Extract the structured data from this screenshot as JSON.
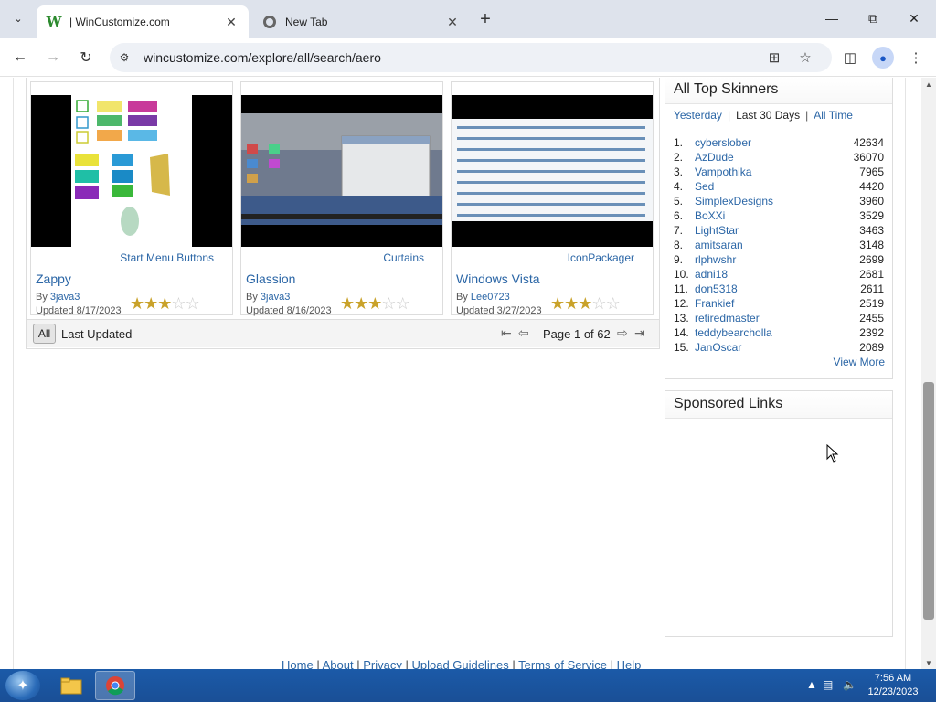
{
  "browser": {
    "tabs": [
      {
        "title": "| WinCustomize.com",
        "active": true
      },
      {
        "title": "New Tab",
        "active": false
      }
    ],
    "url": "wincustomize.com/explore/all/search/aero"
  },
  "results": [
    {
      "category": "Start Menu Buttons",
      "title": "Zappy",
      "by_prefix": "By",
      "author": "3java3",
      "updated": "Updated 8/17/2023",
      "rating": 3
    },
    {
      "category": "Curtains",
      "title": "Glassion",
      "by_prefix": "By",
      "author": "3java3",
      "updated": "Updated 8/16/2023",
      "rating": 3
    },
    {
      "category": "IconPackager",
      "title": "Windows Vista",
      "by_prefix": "By",
      "author": "Lee0723",
      "updated": "Updated 3/27/2023",
      "rating": 3
    }
  ],
  "pager": {
    "all_label": "All",
    "sort_label": "Last Updated",
    "page_info": "Page 1 of 62"
  },
  "top_skinners": {
    "title": "All Top Skinners",
    "filters": {
      "yesterday": "Yesterday",
      "last30": "Last 30 Days",
      "alltime": "All Time",
      "sep": "|"
    },
    "list": [
      {
        "rank": "1.",
        "name": "cyberslober",
        "count": "42634"
      },
      {
        "rank": "2.",
        "name": "AzDude",
        "count": "36070"
      },
      {
        "rank": "3.",
        "name": "Vampothika",
        "count": "7965"
      },
      {
        "rank": "4.",
        "name": "Sed",
        "count": "4420"
      },
      {
        "rank": "5.",
        "name": "SimplexDesigns",
        "count": "3960"
      },
      {
        "rank": "6.",
        "name": "BoXXi",
        "count": "3529"
      },
      {
        "rank": "7.",
        "name": "LightStar",
        "count": "3463"
      },
      {
        "rank": "8.",
        "name": "amitsaran",
        "count": "3148"
      },
      {
        "rank": "9.",
        "name": "rlphwshr",
        "count": "2699"
      },
      {
        "rank": "10.",
        "name": "adni18",
        "count": "2681"
      },
      {
        "rank": "11.",
        "name": "don5318",
        "count": "2611"
      },
      {
        "rank": "12.",
        "name": "Frankief",
        "count": "2519"
      },
      {
        "rank": "13.",
        "name": "retiredmaster",
        "count": "2455"
      },
      {
        "rank": "14.",
        "name": "teddybearcholla",
        "count": "2392"
      },
      {
        "rank": "15.",
        "name": "JanOscar",
        "count": "2089"
      }
    ],
    "view_more": "View More"
  },
  "sponsored": {
    "title": "Sponsored Links"
  },
  "footer": {
    "links": [
      "Home",
      "About",
      "Privacy",
      "Upload Guidelines",
      "Terms of Service",
      "Help"
    ],
    "sep": "|"
  },
  "taskbar": {
    "time": "7:56 AM",
    "date": "12/23/2023"
  },
  "colors": {
    "link": "#2b66a6",
    "star": "#c9a22a",
    "taskbar": "#1b5aa8"
  }
}
